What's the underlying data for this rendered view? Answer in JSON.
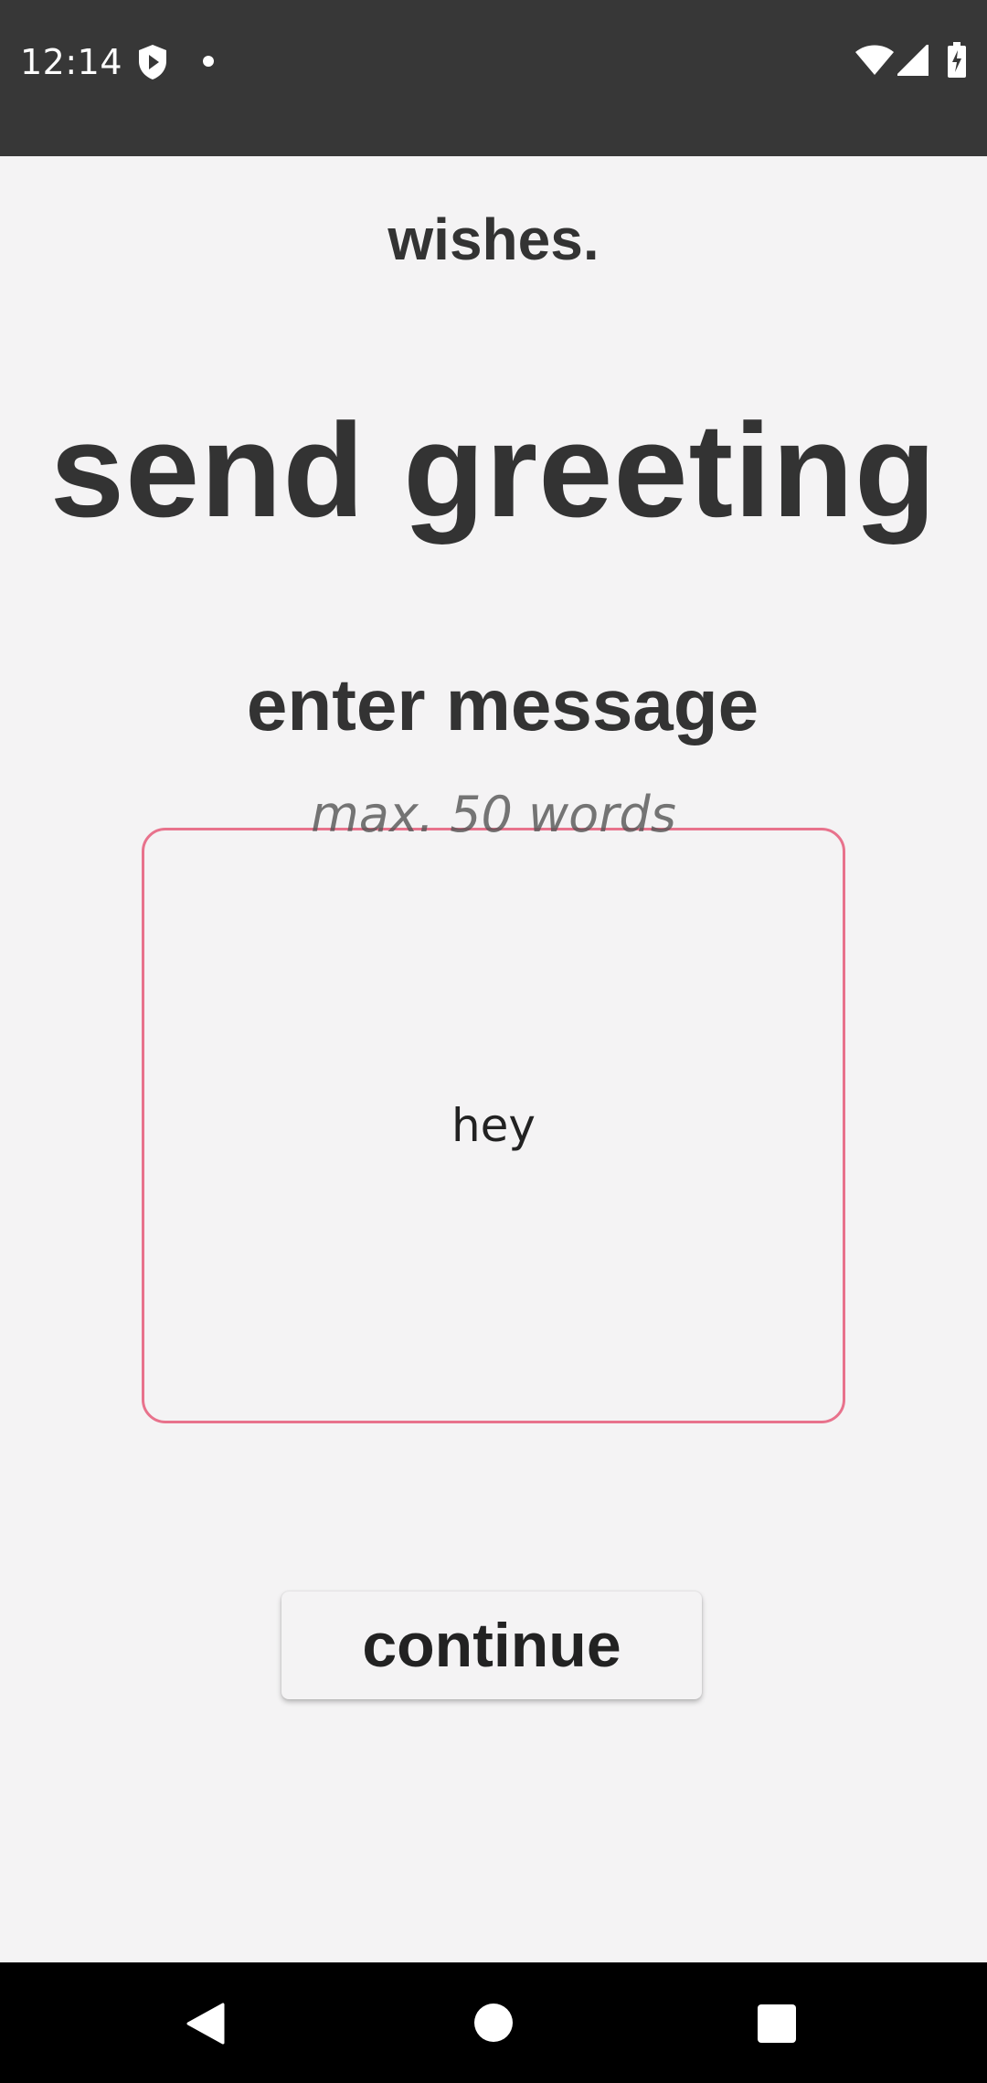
{
  "status_bar": {
    "time": "12:14",
    "icons": [
      "shield-play-icon",
      "notification-dot-icon",
      "wifi-icon",
      "signal-icon",
      "battery-charging-icon"
    ]
  },
  "app": {
    "title": "wishes.",
    "heading": "send greeting",
    "section_label": "enter message",
    "hint": "max. 50 words",
    "message_value": "hey",
    "continue_label": "continue"
  },
  "colors": {
    "background": "#f4f3f4",
    "status_bar": "#373737",
    "text": "#333333",
    "input_border": "#e8728c",
    "nav_bar": "#000000"
  },
  "nav_bar": {
    "buttons": [
      "back-icon",
      "home-icon",
      "recents-icon"
    ]
  }
}
